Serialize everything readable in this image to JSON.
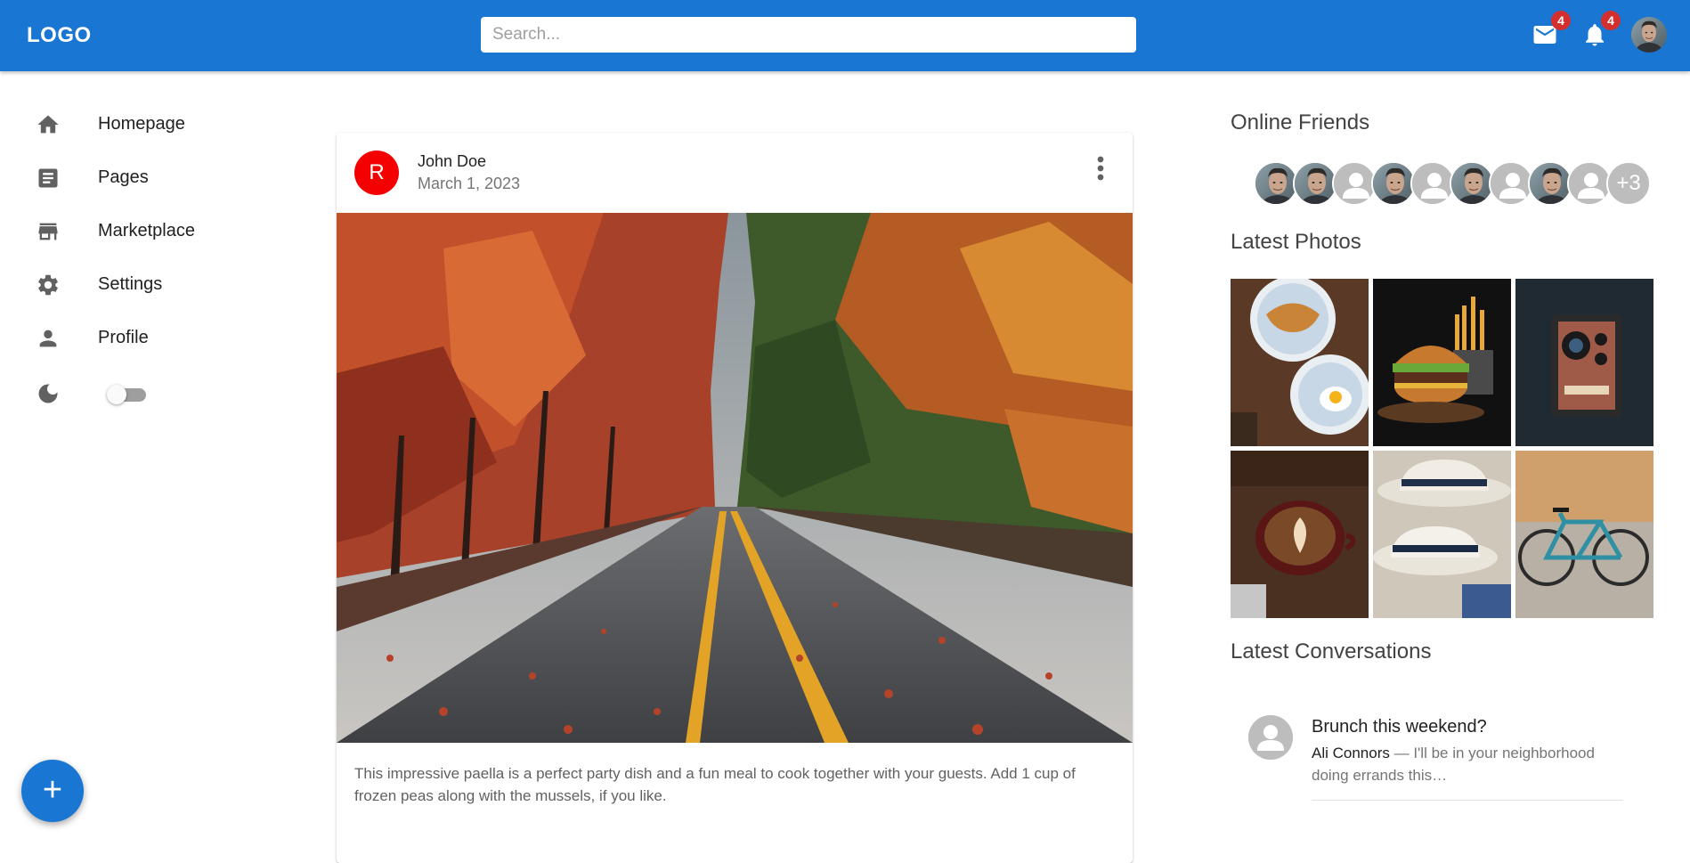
{
  "header": {
    "logo": "LOGO",
    "search_placeholder": "Search...",
    "mail_badge": "4",
    "notifications_badge": "4",
    "brand_color": "#1976d2"
  },
  "sidebar": {
    "items": [
      {
        "label": "Homepage",
        "icon": "home-icon"
      },
      {
        "label": "Pages",
        "icon": "article-icon"
      },
      {
        "label": "Marketplace",
        "icon": "storefront-icon"
      },
      {
        "label": "Settings",
        "icon": "gear-icon"
      },
      {
        "label": "Profile",
        "icon": "person-icon"
      }
    ],
    "dark_mode_enabled": false
  },
  "fab": {
    "label": "+"
  },
  "post": {
    "avatar_letter": "R",
    "author": "John Doe",
    "date": "March 1, 2023",
    "text": "This impressive paella is a perfect party dish and a fun meal to cook together with your guests. Add 1 cup of frozen peas along with the mussels, if you like.",
    "avatar_color": "#f40000"
  },
  "right": {
    "online_friends_title": "Online Friends",
    "friends_more": "+3",
    "latest_photos_title": "Latest Photos",
    "latest_conversations_title": "Latest Conversations",
    "conversation": {
      "title": "Brunch this weekend?",
      "sender": "Ali Connors",
      "snippet": " — I'll be in your neighborhood doing errands this…"
    }
  }
}
